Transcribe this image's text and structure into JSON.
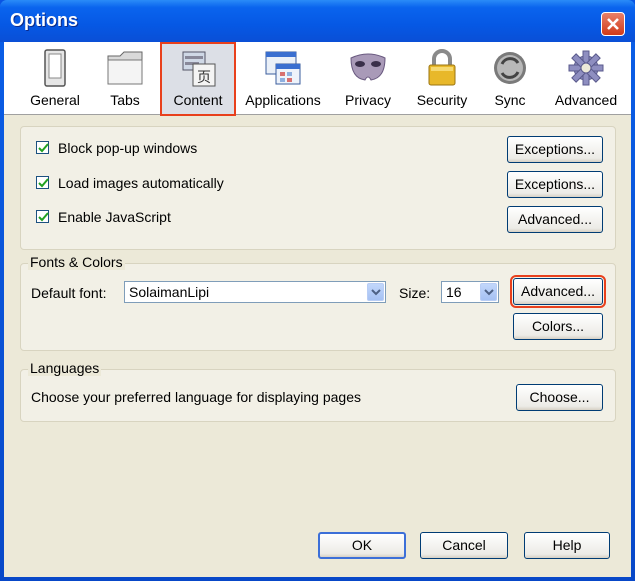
{
  "window": {
    "title": "Options"
  },
  "tabs": [
    {
      "label": "General",
      "icon": "general-icon"
    },
    {
      "label": "Tabs",
      "icon": "tabs-icon"
    },
    {
      "label": "Content",
      "icon": "content-icon",
      "selected": true
    },
    {
      "label": "Applications",
      "icon": "applications-icon"
    },
    {
      "label": "Privacy",
      "icon": "privacy-mask-icon"
    },
    {
      "label": "Security",
      "icon": "padlock-icon"
    },
    {
      "label": "Sync",
      "icon": "sync-icon"
    },
    {
      "label": "Advanced",
      "icon": "gear-icon"
    }
  ],
  "content": {
    "popups": {
      "label": "Block pop-up windows",
      "checked": true,
      "button": "Exceptions..."
    },
    "images": {
      "label": "Load images automatically",
      "checked": true,
      "button": "Exceptions..."
    },
    "javascript": {
      "label": "Enable JavaScript",
      "checked": true,
      "button": "Advanced..."
    }
  },
  "fonts": {
    "title": "Fonts & Colors",
    "default_font_label": "Default font:",
    "default_font_value": "SolaimanLipi",
    "size_label": "Size:",
    "size_value": "16",
    "advanced_button": "Advanced...",
    "colors_button": "Colors..."
  },
  "languages": {
    "title": "Languages",
    "description": "Choose your preferred language for displaying pages",
    "choose_button": "Choose..."
  },
  "footer": {
    "ok": "OK",
    "cancel": "Cancel",
    "help": "Help"
  },
  "colors": {
    "titlebar": "#0a5fe8",
    "highlight": "#e8401c",
    "dialog_bg": "#ece9d8"
  }
}
